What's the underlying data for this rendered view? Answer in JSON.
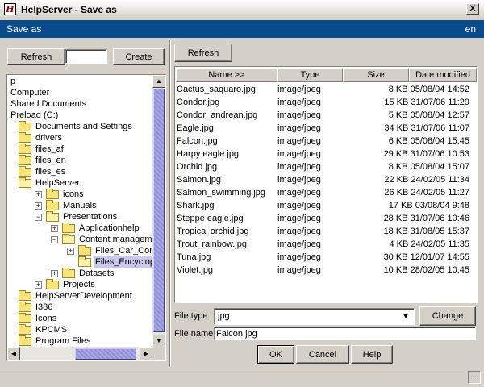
{
  "window": {
    "title": "HelpServer - Save as",
    "icon": "H",
    "close_label": "X"
  },
  "header": {
    "title": "Save as",
    "lang": "en"
  },
  "left_toolbar": {
    "refresh_label": "Refresh",
    "new_folder_value": "",
    "create_label": "Create"
  },
  "tree": {
    "items": [
      {
        "label": "p",
        "depth": 0,
        "icon": "none",
        "expander": "none"
      },
      {
        "label": "Computer",
        "depth": 0,
        "icon": "none",
        "expander": "none"
      },
      {
        "label": "Shared Documents",
        "depth": 0,
        "icon": "none",
        "expander": "none"
      },
      {
        "label": "Preload (C:)",
        "depth": 0,
        "icon": "none",
        "expander": "none"
      },
      {
        "label": "Documents and Settings",
        "depth": 1,
        "icon": "folder",
        "expander": "none"
      },
      {
        "label": "drivers",
        "depth": 1,
        "icon": "folder",
        "expander": "none"
      },
      {
        "label": "files_af",
        "depth": 1,
        "icon": "folder",
        "expander": "none"
      },
      {
        "label": "files_en",
        "depth": 1,
        "icon": "folder",
        "expander": "none"
      },
      {
        "label": "files_es",
        "depth": 1,
        "icon": "folder",
        "expander": "none"
      },
      {
        "label": "HelpServer",
        "depth": 1,
        "icon": "folder-open",
        "expander": "none"
      },
      {
        "label": "icons",
        "depth": 2,
        "icon": "folder",
        "expander": "plus"
      },
      {
        "label": "Manuals",
        "depth": 2,
        "icon": "folder",
        "expander": "plus"
      },
      {
        "label": "Presentations",
        "depth": 2,
        "icon": "folder-open",
        "expander": "minus"
      },
      {
        "label": "Applicationhelp",
        "depth": 3,
        "icon": "folder",
        "expander": "plus"
      },
      {
        "label": "Content management",
        "depth": 3,
        "icon": "folder-open",
        "expander": "minus"
      },
      {
        "label": "Files_Car_Compone",
        "depth": 4,
        "icon": "folder",
        "expander": "plus"
      },
      {
        "label": "Files_Encyclopedia",
        "depth": 4,
        "icon": "folder-open",
        "expander": "none",
        "selected": true
      },
      {
        "label": "Datasets",
        "depth": 3,
        "icon": "folder",
        "expander": "plus"
      },
      {
        "label": "Projects",
        "depth": 2,
        "icon": "folder",
        "expander": "plus"
      },
      {
        "label": "HelpServerDevelopment",
        "depth": 1,
        "icon": "folder",
        "expander": "none"
      },
      {
        "label": "I386",
        "depth": 1,
        "icon": "folder",
        "expander": "none"
      },
      {
        "label": "Icons",
        "depth": 1,
        "icon": "folder",
        "expander": "none"
      },
      {
        "label": "KPCMS",
        "depth": 1,
        "icon": "folder",
        "expander": "none"
      },
      {
        "label": "Program Files",
        "depth": 1,
        "icon": "folder",
        "expander": "none"
      }
    ]
  },
  "right_toolbar": {
    "refresh_label": "Refresh"
  },
  "file_table": {
    "columns": [
      "Name >>",
      "Type",
      "Size",
      "Date modified"
    ],
    "rows": [
      {
        "name": "Cactus_saquaro.jpg",
        "type": "image/jpeg",
        "size_date": "8 KB 05/08/04 14:52"
      },
      {
        "name": "Condor.jpg",
        "type": "image/jpeg",
        "size_date": "15 KB 31/07/06 11:29"
      },
      {
        "name": "Condor_andrean.jpg",
        "type": "image/jpeg",
        "size_date": "5 KB 05/08/04 12:57"
      },
      {
        "name": "Eagle.jpg",
        "type": "image/jpeg",
        "size_date": "34 KB 31/07/06 11:07"
      },
      {
        "name": "Falcon.jpg",
        "type": "image/jpeg",
        "size_date": "6 KB 05/08/04 15:45"
      },
      {
        "name": "Harpy eagle.jpg",
        "type": "image/jpeg",
        "size_date": "29 KB 31/07/06 10:53"
      },
      {
        "name": "Orchid.jpg",
        "type": "image/jpeg",
        "size_date": "8 KB 05/08/04 15:07"
      },
      {
        "name": "Salmon.jpg",
        "type": "image/jpeg",
        "size_date": "22 KB 24/02/05 11:34"
      },
      {
        "name": "Salmon_swimming.jpg",
        "type": "image/jpeg",
        "size_date": "26 KB 24/02/05 11:27"
      },
      {
        "name": "Shark.jpg",
        "type": "image/jpeg",
        "size_date": "17 KB 03/08/04 9:48"
      },
      {
        "name": "Steppe eagle.jpg",
        "type": "image/jpeg",
        "size_date": "28 KB 31/07/06 10:46"
      },
      {
        "name": "Tropical orchid.jpg",
        "type": "image/jpeg",
        "size_date": "18 KB 31/08/05 15:37"
      },
      {
        "name": "Trout_rainbow.jpg",
        "type": "image/jpeg",
        "size_date": "4 KB 24/02/05 11:35"
      },
      {
        "name": "Tuna.jpg",
        "type": "image/jpeg",
        "size_date": "30 KB 12/01/07 14:55"
      },
      {
        "name": "Violet.jpg",
        "type": "image/jpeg",
        "size_date": "10 KB 28/02/05 10:45"
      }
    ]
  },
  "file_type": {
    "label": "File type",
    "value": "jpg",
    "change_label": "Change"
  },
  "file_name": {
    "label": "File name",
    "value": "Falcon.jpg"
  },
  "buttons": {
    "ok": "OK",
    "cancel": "Cancel",
    "help": "Help"
  },
  "status": {
    "icon": "resize-grip-icon",
    "text": "..."
  },
  "colors": {
    "header_bg": "#0a4b8c",
    "selection": "#c9c9f0",
    "folder": "#f8e37a",
    "scroll_thumb": "#8f8fd6"
  }
}
